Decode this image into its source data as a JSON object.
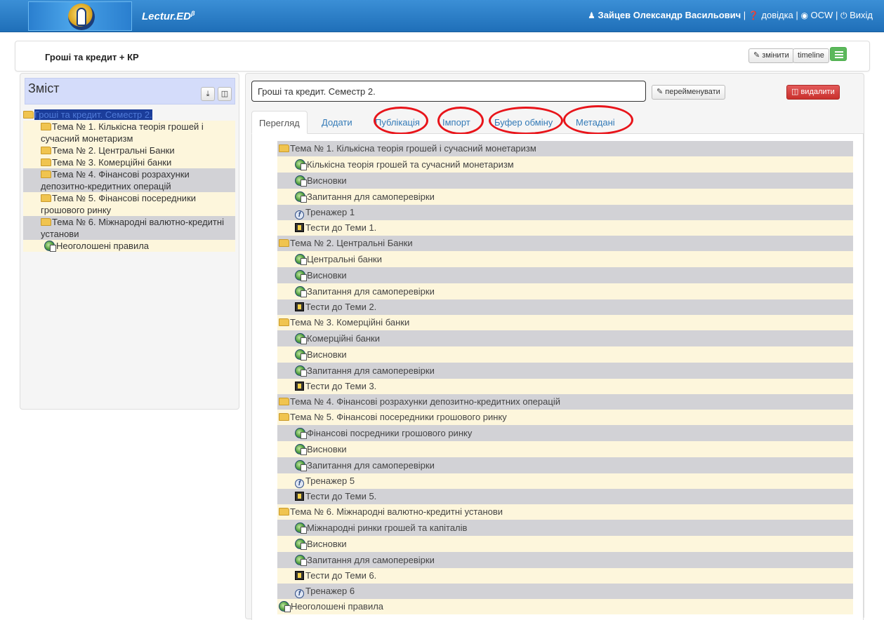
{
  "app": {
    "brand": "Lectur.ED",
    "brand_sup": "β",
    "user": "Зайцев Олександр Васильович",
    "sep": "|",
    "help": "довідка",
    "ocw": "OCW",
    "exit": "Вихід"
  },
  "doc": {
    "title": "Гроші та кредит + КР",
    "edit_label": "змінити",
    "timeline_label": "timeline"
  },
  "toc": {
    "title": "Зміст",
    "root": "Гроші та кредит. Семестр 2.",
    "items": [
      {
        "label": "Тема № 1. Кількісна теорія грошей і сучасний монетаризм",
        "icon": "folder"
      },
      {
        "label": "Тема № 2. Центральні Банки",
        "icon": "folder"
      },
      {
        "label": "Тема № 3. Комерційні банки",
        "icon": "folder"
      },
      {
        "label": "Тема № 4. Фінансові розрахунки депозитно-кредитних операцій",
        "icon": "folder"
      },
      {
        "label": "Тема № 5. Фінансові посередники грошового ринку",
        "icon": "folder"
      },
      {
        "label": "Тема № 6. Міжнародні валютно-кредитні установи",
        "icon": "folder"
      },
      {
        "label": "Неоголошені правила",
        "icon": "globe"
      }
    ]
  },
  "editor": {
    "input_value": "Гроші та кредит. Семестр 2.",
    "rename_label": "перейменувати",
    "delete_label": "видалити",
    "tabs": [
      "Перегляд",
      "Додати",
      "Публікація",
      "Імпорт",
      "Буфер обміну",
      "Метадані"
    ]
  },
  "content": [
    {
      "text": "Тема № 1. Кількісна теорія грошей і сучасний монетаризм",
      "level": 0,
      "icon": "folder"
    },
    {
      "text": "Кількісна теорія грошей та сучасний монетаризм",
      "level": 1,
      "icon": "globe"
    },
    {
      "text": "Висновки",
      "level": 1,
      "icon": "globe"
    },
    {
      "text": "Запитання для самоперевірки",
      "level": 1,
      "icon": "globe"
    },
    {
      "text": "Тренажер 1",
      "level": 1,
      "icon": "flash"
    },
    {
      "text": "Тести до Теми 1.",
      "level": 1,
      "icon": "test"
    },
    {
      "text": "Тема № 2. Центральні Банки",
      "level": 0,
      "icon": "folder"
    },
    {
      "text": "Центральні банки",
      "level": 1,
      "icon": "globe"
    },
    {
      "text": "Висновки",
      "level": 1,
      "icon": "globe"
    },
    {
      "text": "Запитання для самоперевірки",
      "level": 1,
      "icon": "globe"
    },
    {
      "text": "Тести до Теми 2.",
      "level": 1,
      "icon": "test"
    },
    {
      "text": "Тема № 3. Комерційні банки",
      "level": 0,
      "icon": "folder"
    },
    {
      "text": "Комерційні банки",
      "level": 1,
      "icon": "globe"
    },
    {
      "text": "Висновки",
      "level": 1,
      "icon": "globe"
    },
    {
      "text": "Запитання для самоперевірки",
      "level": 1,
      "icon": "globe"
    },
    {
      "text": "Тести до Теми 3.",
      "level": 1,
      "icon": "test"
    },
    {
      "text": "Тема № 4. Фінансові розрахунки депозитно-кредитних операцій",
      "level": 0,
      "icon": "folder"
    },
    {
      "text": "Тема № 5. Фінансові посередники грошового ринку",
      "level": 0,
      "icon": "folder"
    },
    {
      "text": "Фінансові посредники грошового ринку",
      "level": 1,
      "icon": "globe"
    },
    {
      "text": "Висновки",
      "level": 1,
      "icon": "globe"
    },
    {
      "text": "Запитання для самоперевірки",
      "level": 1,
      "icon": "globe"
    },
    {
      "text": "Тренажер 5",
      "level": 1,
      "icon": "flash"
    },
    {
      "text": "Тести до Теми 5.",
      "level": 1,
      "icon": "test"
    },
    {
      "text": "Тема № 6. Міжнародні валютно-кредитні установи",
      "level": 0,
      "icon": "folder"
    },
    {
      "text": "Міжнародні ринки грошей та капіталів",
      "level": 1,
      "icon": "globe"
    },
    {
      "text": "Висновки",
      "level": 1,
      "icon": "globe"
    },
    {
      "text": "Запитання для самоперевірки",
      "level": 1,
      "icon": "globe"
    },
    {
      "text": "Тести до Теми 6.",
      "level": 1,
      "icon": "test"
    },
    {
      "text": "Тренажер 6",
      "level": 1,
      "icon": "flash"
    },
    {
      "text": "Неоголошені правила",
      "level": 0,
      "icon": "globe"
    }
  ],
  "colors": {
    "accent": "#337ab7",
    "danger": "#c9302c",
    "success": "#5cb85c",
    "highlight": "#e8141a"
  }
}
